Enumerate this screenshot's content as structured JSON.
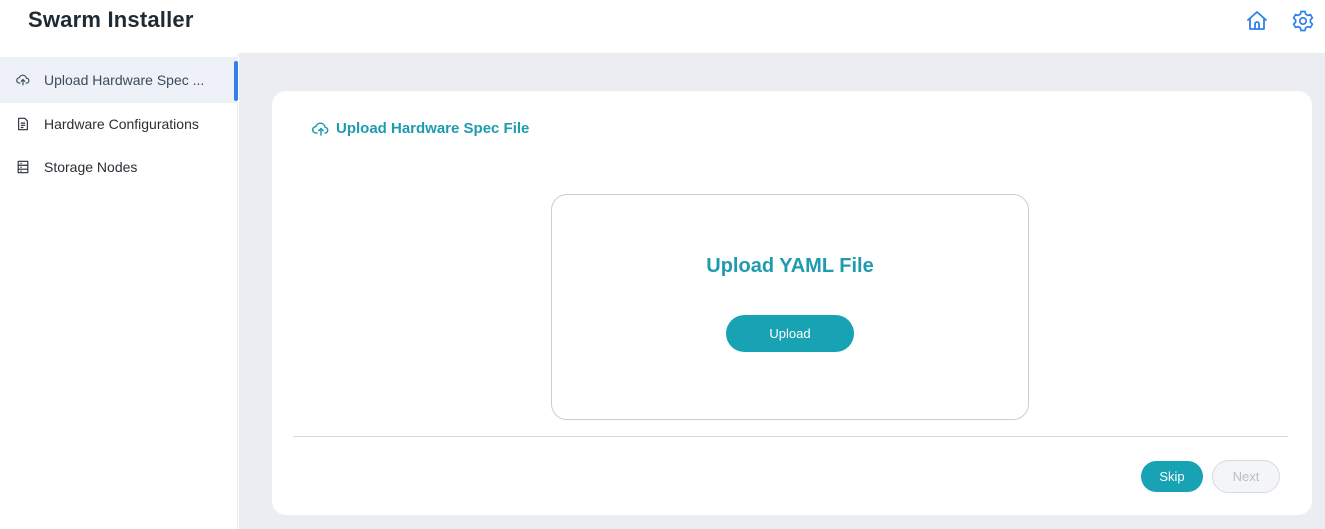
{
  "app": {
    "title": "Swarm Installer"
  },
  "header": {
    "icons": [
      {
        "name": "home-icon",
        "color": "#2f80ed"
      },
      {
        "name": "gear-icon",
        "color": "#2f80ed"
      }
    ]
  },
  "sidebar": {
    "items": [
      {
        "label": "Upload Hardware Spec ...",
        "icon": "cloud-upload-icon",
        "active": true
      },
      {
        "label": "Hardware Configurations",
        "icon": "document-icon",
        "active": false
      },
      {
        "label": "Storage Nodes",
        "icon": "server-icon",
        "active": false
      }
    ]
  },
  "main": {
    "section_title": "Upload Hardware Spec File",
    "upload": {
      "heading": "Upload YAML File",
      "button_label": "Upload"
    },
    "actions": {
      "skip_label": "Skip",
      "next_label": "Next",
      "next_disabled": true
    }
  },
  "colors": {
    "accent": "#17a3b3",
    "title_teal": "#1f9bb0",
    "nav_active_bar": "#2f80ed",
    "page_background": "#ececf3"
  }
}
